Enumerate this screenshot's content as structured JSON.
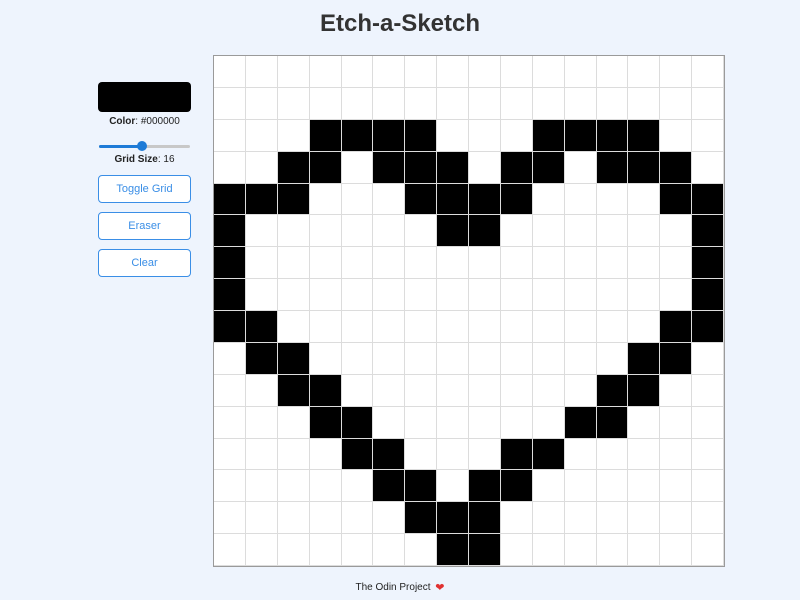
{
  "title": "Etch-a-Sketch",
  "color": {
    "label": "Color",
    "value": "#000000",
    "swatch_hex": "#000000"
  },
  "grid_size": {
    "label": "Grid Size",
    "value": "16",
    "slider_fraction": 0.47
  },
  "buttons": {
    "toggle_grid": "Toggle Grid",
    "eraser": "Eraser",
    "clear": "Clear"
  },
  "footer": {
    "text": "The Odin Project",
    "heart_icon": "heart-icon"
  },
  "accent_color": "#3a8ee6",
  "grid": {
    "rows": 16,
    "cols": 16,
    "pixels": [
      "0000000000000000",
      "0000000000000000",
      "0001111000111100",
      "0011011101101110",
      "1110001111000011",
      "1000000110000001",
      "1000000000000001",
      "1000000000000001",
      "1100000000000011",
      "0110000000000110",
      "0011000000001100",
      "0001100000011000",
      "0000110001100000",
      "0000011011000000",
      "0000001110000000",
      "0000000110000000"
    ]
  }
}
